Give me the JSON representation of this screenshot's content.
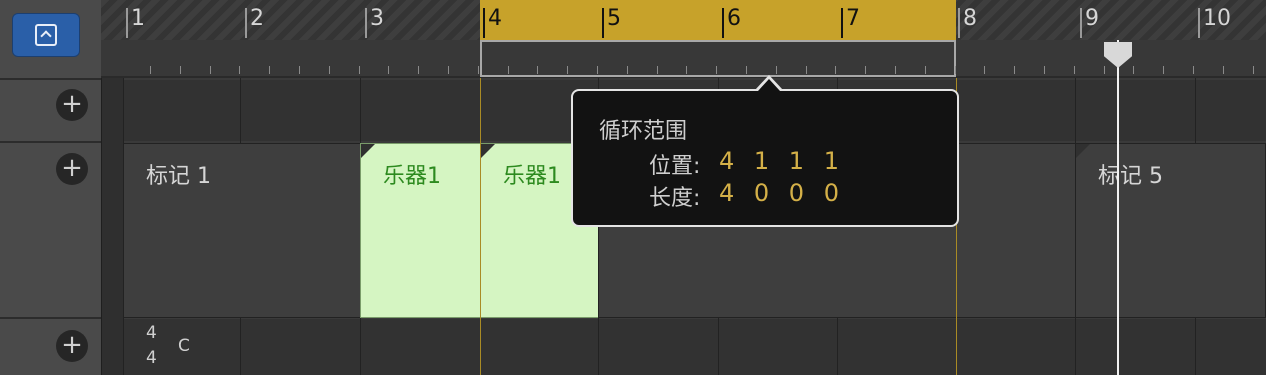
{
  "bars": [
    "1",
    "2",
    "3",
    "4",
    "5",
    "6",
    "7",
    "8",
    "9",
    "10"
  ],
  "regions": {
    "marker1": "标记 1",
    "inst1a": "乐器1",
    "inst1b": "乐器1",
    "marker5": "标记 5"
  },
  "tooltip": {
    "title": "循环范围",
    "position_label": "位置:",
    "position_value": "4 1 1 1",
    "length_label": "长度:",
    "length_value": "4 0 0 0"
  },
  "signature": {
    "numerator": "4",
    "denominator": "4",
    "key": "C"
  },
  "colors": {
    "cycle": "#c7a22a",
    "instrument_region": "#d5f5c2",
    "value_text": "#d4b048"
  },
  "icons": [
    "show-editor-icon",
    "plus-icon",
    "playhead-icon"
  ]
}
